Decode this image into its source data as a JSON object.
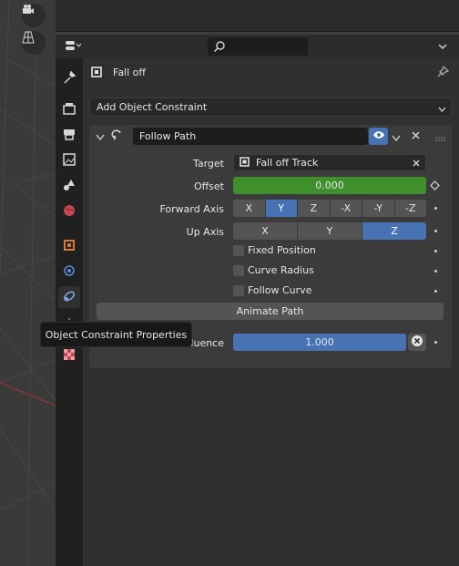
{
  "header": {
    "search_placeholder": ""
  },
  "object_name": "Fall off",
  "add_constraint_label": "Add Object Constraint",
  "constraint": {
    "name": "Follow Path",
    "target_label": "Target",
    "target_value": "Fall off Track",
    "offset_label": "Offset",
    "offset_value": "0.000",
    "forward_axis_label": "Forward Axis",
    "forward_axis_options": [
      "X",
      "Y",
      "Z",
      "-X",
      "-Y",
      "-Z"
    ],
    "forward_axis_selected": "Y",
    "up_axis_label": "Up Axis",
    "up_axis_options": [
      "X",
      "Y",
      "Z"
    ],
    "up_axis_selected": "Z",
    "checkboxes": [
      {
        "label": "Fixed Position",
        "checked": false
      },
      {
        "label": "Curve Radius",
        "checked": false
      },
      {
        "label": "Follow Curve",
        "checked": false
      }
    ],
    "animate_path_label": "Animate Path",
    "influence_label": "Influence",
    "influence_value": "1.000",
    "influence_fraction": 1.0
  },
  "tooltip": "Object Constraint Properties",
  "colors": {
    "accent": "#4772b3",
    "offset_green": "#3f8f2c",
    "selected_orange": "#d67a36"
  }
}
